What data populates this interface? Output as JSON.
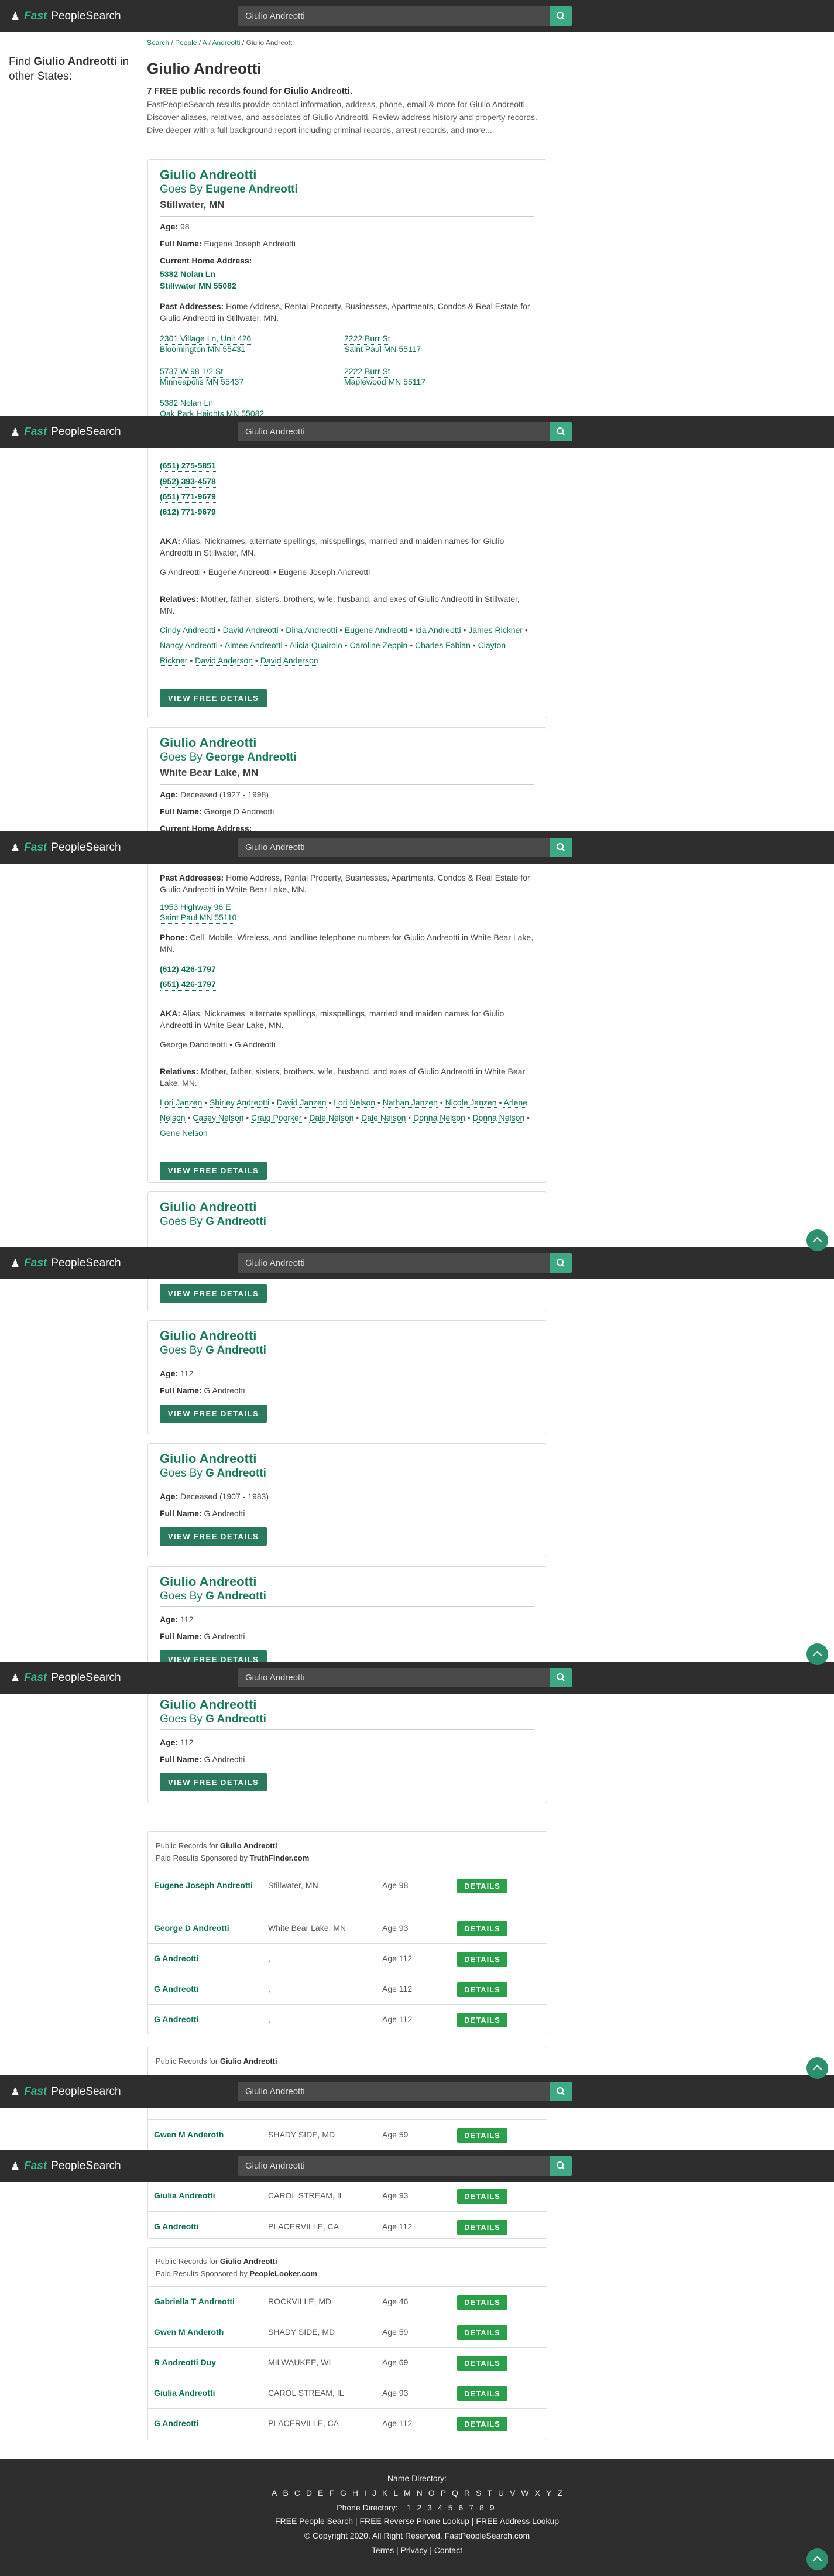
{
  "header": {
    "logo_fast": "Fast",
    "logo_people": "PeopleSearch",
    "search_value": "Giulio Andreotti"
  },
  "sidebar": {
    "find_prefix": "Find ",
    "find_name": "Giulio Andreotti",
    "find_suffix": " in other States:"
  },
  "breadcrumb": {
    "search": "Search",
    "sep": " / ",
    "people": "People",
    "letter": "A",
    "surname": "Andreotti",
    "current": "Giulio Andreotti"
  },
  "page_title": "Giulio Andreotti",
  "intro_bold": "7 FREE public records found for Giulio Andreotti.",
  "intro_text": "FastPeopleSearch results provide contact information, address, phone, email & more for Giulio Andreotti. Discover aliases, relatives, and associates of Giulio Andreotti. Review address history and property records. Dive deeper with a full background report including criminal records, arrest records, and more...",
  "labels": {
    "goes_by": "Goes By ",
    "age": "Age:",
    "full_name": "Full Name:",
    "current_home": "Current Home Address:",
    "past_addresses": "Past Addresses:",
    "phone": "Phone:",
    "aka": "AKA:",
    "relatives": "Relatives:",
    "view_free_details": "VIEW FREE DETAILS",
    "details": "DETAILS",
    "public_records_for": "Public Records for ",
    "paid_results": "Paid Results Sponsored by "
  },
  "card1": {
    "name": "Giulio Andreotti",
    "goes_by": "Eugene Andreotti",
    "location": "Stillwater, MN",
    "age": "98",
    "full_name": "Eugene Joseph Andreotti",
    "current_addr_1": "5382 Nolan Ln",
    "current_addr_2": "Stillwater MN 55082",
    "past_desc": "Home Address, Rental Property, Businesses, Apartments, Condos & Real Estate for Giulio Andreotti in Stillwater, MN.",
    "past": [
      {
        "l1": "2301 Village Ln, Unit 426",
        "l2": "Bloomington MN 55431"
      },
      {
        "l1": "2222 Burr St",
        "l2": "Saint Paul MN 55117"
      },
      {
        "l1": "5737 W 98 1/2 St",
        "l2": "Minneapolis MN 55437"
      },
      {
        "l1": "2222 Burr St",
        "l2": "Maplewood MN 55117"
      },
      {
        "l1": "5382 Nolan Ln",
        "l2": "Oak Park Heights MN 55082"
      }
    ],
    "phones": [
      "(651) 275-5851",
      "(952) 393-4578",
      "(651) 771-9679",
      "(612) 771-9679"
    ],
    "aka_desc": "Alias, Nicknames, alternate spellings, misspellings, married and maiden names for Giulio Andreotti in Stillwater, MN.",
    "aka_list": "G Andreotti • Eugene Andreotti • Eugene Joseph Andreotti",
    "rel_desc": "Mother, father, sisters, brothers, wife, husband, and exes of Giulio Andreotti in Stillwater, MN.",
    "relatives": [
      "Cindy Andreotti",
      "David Andreotti",
      "Dina Andreotti",
      "Eugene Andreotti",
      "Ida Andreotti",
      "James Rickner",
      "Nancy Andreotti",
      "Aimee Andreotti",
      "Alicia Quairolo",
      "Caroline Zeppin",
      "Charles Fabian",
      "Clayton Rickner",
      "David Anderson",
      "David Anderson"
    ]
  },
  "card2": {
    "name": "Giulio Andreotti",
    "goes_by": "George Andreotti",
    "location": "White Bear Lake, MN",
    "age": "Deceased (1927 - 1998)",
    "full_name": "George D Andreotti",
    "past_desc": "Home Address, Rental Property, Businesses, Apartments, Condos & Real Estate for Giulio Andreotti in White Bear Lake, MN.",
    "past_1": "1953 Highway 96 E",
    "past_2": "Saint Paul MN 55110",
    "phone_desc": "Cell, Mobile, Wireless, and landline telephone numbers for Giulio Andreotti in White Bear Lake, MN.",
    "phones": [
      "(612) 426-1797",
      "(651) 426-1797"
    ],
    "aka_desc": "Alias, Nicknames, alternate spellings, misspellings, married and maiden names for Giulio Andreotti in White Bear Lake, MN.",
    "aka_list": "George Dandreotti • G Andreotti",
    "rel_desc": "Mother, father, sisters, brothers, wife, husband, and exes of Giulio Andreotti in White Bear Lake, MN.",
    "relatives": [
      "Lori Janzen",
      "Shirley Andreotti",
      "David Janzen",
      "Lori Nelson",
      "Nathan Janzen",
      "Nicole Janzen",
      "Arlene Nelson",
      "Casey Nelson",
      "Craig Poorker",
      "Dale Nelson",
      "Dale Nelson",
      "Donna Nelson",
      "Donna Nelson",
      "Gene Nelson"
    ]
  },
  "card3": {
    "name": "Giulio Andreotti",
    "goes_by": "G Andreotti"
  },
  "card4": {
    "name": "Giulio Andreotti",
    "goes_by": "G Andreotti",
    "age": "112",
    "full_name": "G Andreotti"
  },
  "card5": {
    "name": "Giulio Andreotti",
    "goes_by": "G Andreotti",
    "age": "Deceased (1907 - 1983)",
    "full_name": "G Andreotti"
  },
  "card6": {
    "name": "Giulio Andreotti",
    "goes_by": "G Andreotti",
    "age": "112",
    "full_name": "G Andreotti"
  },
  "card7": {
    "name": "Giulio Andreotti",
    "goes_by": "G Andreotti",
    "age": "112",
    "full_name": "G Andreotti"
  },
  "public1": {
    "name": "Giulio Andreotti",
    "sponsor": "TruthFinder.com",
    "rows": [
      {
        "name": "Eugene Joseph Andreotti",
        "loc": "Stillwater, MN",
        "age": "Age 98"
      },
      {
        "name": "George D Andreotti",
        "loc": "White Bear Lake, MN",
        "age": "Age 93"
      },
      {
        "name": "G Andreotti",
        "loc": ",",
        "age": "Age 112"
      },
      {
        "name": "G Andreotti",
        "loc": ",",
        "age": "Age 112"
      },
      {
        "name": "G Andreotti",
        "loc": ",",
        "age": "Age 112"
      }
    ]
  },
  "public2": {
    "name": "Giulio Andreotti",
    "rows": [
      {
        "name": "Gwen M Anderoth",
        "loc": "SHADY SIDE, MD",
        "age": "Age 59"
      },
      {
        "name": "Giulia Andreotti",
        "loc": "CAROL STREAM, IL",
        "age": "Age 93"
      },
      {
        "name": "G Andreotti",
        "loc": "PLACERVILLE, CA",
        "age": "Age 112"
      }
    ]
  },
  "public3": {
    "name": "Giulio Andreotti",
    "sponsor": "PeopleLooker.com",
    "rows": [
      {
        "name": "Gabriella T Andreotti",
        "loc": "ROCKVILLE, MD",
        "age": "Age 46"
      },
      {
        "name": "Gwen M Anderoth",
        "loc": "SHADY SIDE, MD",
        "age": "Age 59"
      },
      {
        "name": "R Andreotti Duy",
        "loc": "MILWAUKEE, WI",
        "age": "Age 69"
      },
      {
        "name": "Giulia Andreotti",
        "loc": "CAROL STREAM, IL",
        "age": "Age 93"
      },
      {
        "name": "G Andreotti",
        "loc": "PLACERVILLE, CA",
        "age": "Age 112"
      }
    ]
  },
  "footer": {
    "name_directory": "Name Directory:",
    "letters": [
      "A",
      "B",
      "C",
      "D",
      "E",
      "F",
      "G",
      "H",
      "I",
      "J",
      "K",
      "L",
      "M",
      "N",
      "O",
      "P",
      "Q",
      "R",
      "S",
      "T",
      "U",
      "V",
      "W",
      "X",
      "Y",
      "Z"
    ],
    "phone_directory": "Phone Directory:",
    "digits": [
      "1",
      "2",
      "3",
      "4",
      "5",
      "6",
      "7",
      "8",
      "9"
    ],
    "free_links": "FREE People Search | FREE Reverse Phone Lookup | FREE Address Lookup",
    "copyright": "© Copyright 2020. All Right Reserved. FastPeopleSearch.com",
    "legal": "Terms | Privacy | Contact"
  },
  "colors": {
    "header": "#2e2e2e",
    "accent": "#3cb58e",
    "link": "#0d6e56",
    "details_button": "#2aa04a"
  }
}
